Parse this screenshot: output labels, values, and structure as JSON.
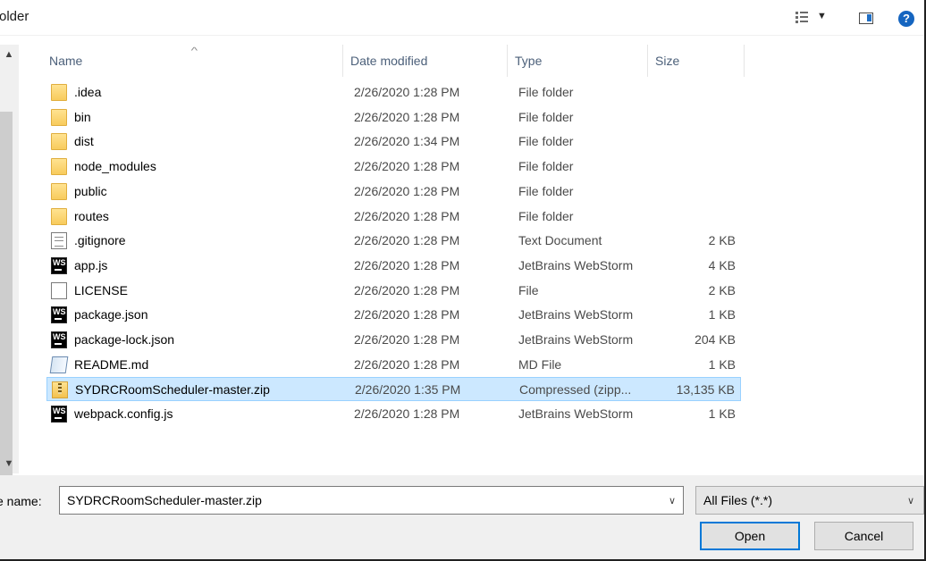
{
  "toolbar": {
    "title": "older",
    "view_icon": "details-view-icon",
    "preview_icon": "preview-pane-icon",
    "help_label": "?"
  },
  "columns": {
    "name": "Name",
    "date": "Date modified",
    "type": "Type",
    "size": "Size"
  },
  "files": [
    {
      "name": ".idea",
      "date": "2/26/2020 1:28 PM",
      "type": "File folder",
      "size": "",
      "icon": "folder-icon"
    },
    {
      "name": "bin",
      "date": "2/26/2020 1:28 PM",
      "type": "File folder",
      "size": "",
      "icon": "folder-icon"
    },
    {
      "name": "dist",
      "date": "2/26/2020 1:34 PM",
      "type": "File folder",
      "size": "",
      "icon": "folder-icon"
    },
    {
      "name": "node_modules",
      "date": "2/26/2020 1:28 PM",
      "type": "File folder",
      "size": "",
      "icon": "folder-icon"
    },
    {
      "name": "public",
      "date": "2/26/2020 1:28 PM",
      "type": "File folder",
      "size": "",
      "icon": "folder-icon"
    },
    {
      "name": "routes",
      "date": "2/26/2020 1:28 PM",
      "type": "File folder",
      "size": "",
      "icon": "folder-icon"
    },
    {
      "name": ".gitignore",
      "date": "2/26/2020 1:28 PM",
      "type": "Text Document",
      "size": "2 KB",
      "icon": "text-document-icon"
    },
    {
      "name": "app.js",
      "date": "2/26/2020 1:28 PM",
      "type": "JetBrains WebStorm",
      "size": "4 KB",
      "icon": "webstorm-icon"
    },
    {
      "name": "LICENSE",
      "date": "2/26/2020 1:28 PM",
      "type": "File",
      "size": "2 KB",
      "icon": "file-icon"
    },
    {
      "name": "package.json",
      "date": "2/26/2020 1:28 PM",
      "type": "JetBrains WebStorm",
      "size": "1 KB",
      "icon": "webstorm-icon"
    },
    {
      "name": "package-lock.json",
      "date": "2/26/2020 1:28 PM",
      "type": "JetBrains WebStorm",
      "size": "204 KB",
      "icon": "webstorm-icon"
    },
    {
      "name": "README.md",
      "date": "2/26/2020 1:28 PM",
      "type": "MD File",
      "size": "1 KB",
      "icon": "md-file-icon"
    },
    {
      "name": "SYDRCRoomScheduler-master.zip",
      "date": "2/26/2020 1:35 PM",
      "type": "Compressed (zipp...",
      "size": "13,135 KB",
      "icon": "zip-icon",
      "selected": true
    },
    {
      "name": "webpack.config.js",
      "date": "2/26/2020 1:28 PM",
      "type": "JetBrains WebStorm",
      "size": "1 KB",
      "icon": "webstorm-icon"
    }
  ],
  "bottom": {
    "file_name_label": "e name:",
    "file_name_value": "SYDRCRoomScheduler-master.zip",
    "file_type_filter": "All Files (*.*)",
    "open_label": "Open",
    "cancel_label": "Cancel"
  },
  "colors": {
    "selection_bg": "#cce8ff",
    "selection_border": "#99d1ff",
    "accent": "#0078d7"
  }
}
